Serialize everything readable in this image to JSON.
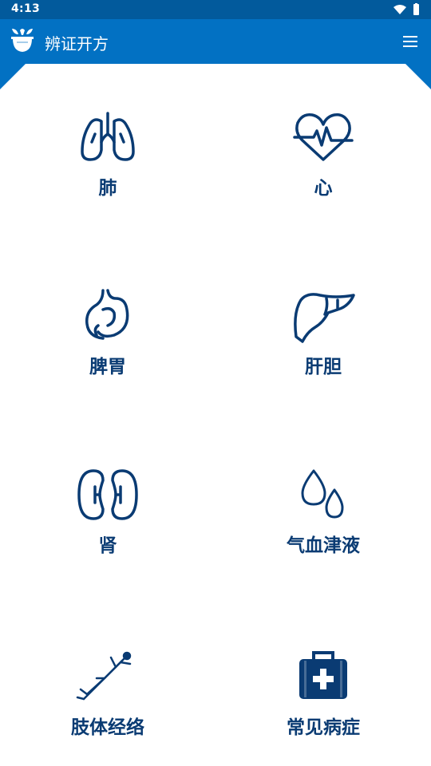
{
  "status_bar": {
    "time": "4:13"
  },
  "app_bar": {
    "title": "辨证开方",
    "menu_icon": "hamburger-menu-icon",
    "logo_icon": "herb-mortar-logo-icon"
  },
  "colors": {
    "primary": "#0271c3",
    "status_bar": "#025a9c",
    "icon_and_label": "#0a3b73"
  },
  "categories": [
    {
      "label": "肺",
      "icon": "lungs-icon"
    },
    {
      "label": "心",
      "icon": "heart-pulse-icon"
    },
    {
      "label": "脾胃",
      "icon": "stomach-icon"
    },
    {
      "label": "肝胆",
      "icon": "liver-icon"
    },
    {
      "label": "肾",
      "icon": "kidneys-icon"
    },
    {
      "label": "气血津液",
      "icon": "droplets-icon"
    },
    {
      "label": "肢体经络",
      "icon": "body-figure-icon"
    },
    {
      "label": "常见病症",
      "icon": "medical-kit-icon"
    }
  ]
}
